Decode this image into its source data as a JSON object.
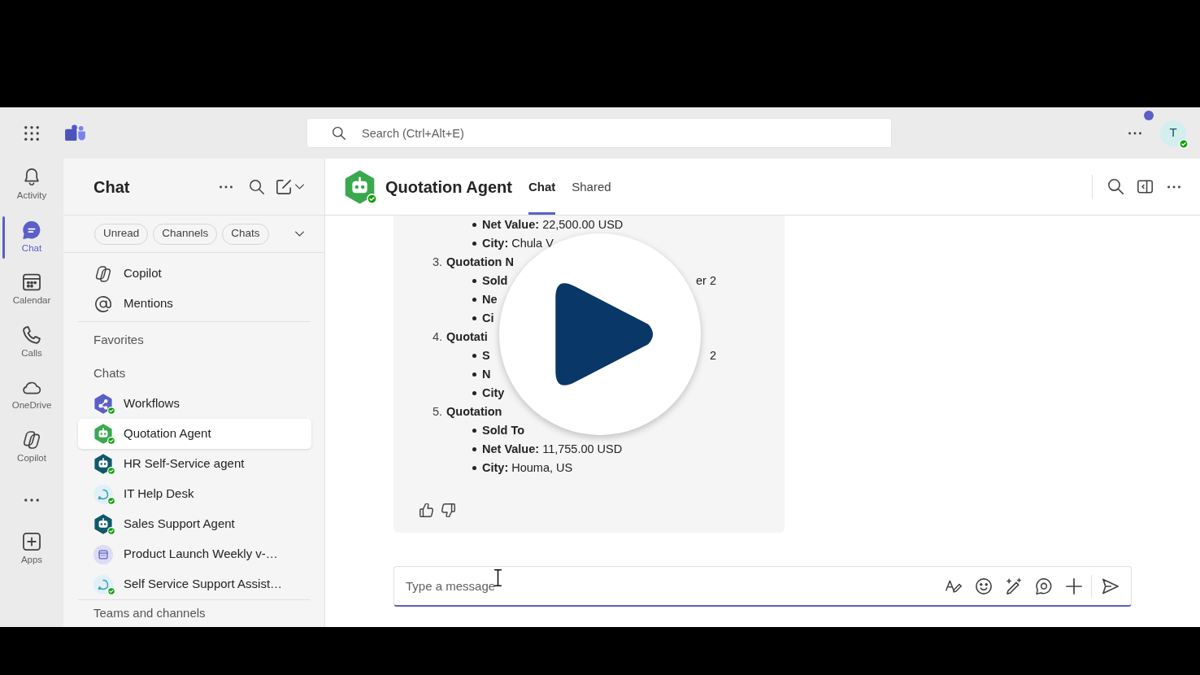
{
  "top_bar": {
    "search": {
      "placeholder": "Search (Ctrl+Alt+E)"
    },
    "account": {
      "initial": "T",
      "online": true
    }
  },
  "rail": {
    "items": [
      {
        "kind": "activity",
        "label": "Activity",
        "selected": false
      },
      {
        "kind": "chat",
        "label": "Chat",
        "selected": true
      },
      {
        "kind": "calendar",
        "label": "Calendar",
        "selected": false
      },
      {
        "kind": "calls",
        "label": "Calls",
        "selected": false
      },
      {
        "kind": "onedrive",
        "label": "OneDrive",
        "selected": false
      },
      {
        "kind": "copilot",
        "label": "Copilot",
        "selected": false
      },
      {
        "kind": "more",
        "selected": false
      },
      {
        "kind": "apps",
        "label": "Apps",
        "selected": false
      }
    ]
  },
  "chat_list": {
    "title": "Chat",
    "filters": [
      {
        "label": "Unread",
        "selected": false
      },
      {
        "label": "Channels",
        "selected": false
      },
      {
        "label": "Chats",
        "selected": false
      }
    ],
    "pinned": [
      {
        "kind": "copilot",
        "label": "Copilot"
      },
      {
        "kind": "mentions",
        "label": "Mentions"
      }
    ],
    "favorites": {
      "title": "Favorites"
    },
    "chats": {
      "title": "Chats",
      "items": [
        {
          "kind": "workflow",
          "label": "Workflows",
          "color": "#5b5fc7",
          "online": true,
          "selected": false
        },
        {
          "kind": "bot",
          "label": "Quotation Agent",
          "color": "#3aa84f",
          "online": true,
          "selected": true
        },
        {
          "kind": "bot",
          "label": "HR Self-Service agent",
          "color": "#0e5a6b",
          "online": true,
          "selected": false
        },
        {
          "kind": "helpdesk",
          "label": "IT Help Desk",
          "color": "#dff1f7",
          "online": true,
          "selected": false
        },
        {
          "kind": "bot",
          "label": "Sales Support Agent",
          "color": "#0e5a6b",
          "online": true,
          "selected": false
        },
        {
          "kind": "meeting",
          "label": "Product Launch Weekly v-…",
          "color": "#dcdcf4",
          "online": false,
          "selected": false
        },
        {
          "kind": "helpdesk",
          "label": "Self Service Support Assist…",
          "color": "#dff1f7",
          "online": true,
          "selected": false
        }
      ]
    },
    "teams": {
      "title": "Teams and channels"
    }
  },
  "conversation": {
    "title": "Quotation Agent",
    "online": true,
    "tabs": [
      {
        "label": "Chat",
        "selected": true
      },
      {
        "label": "Shared",
        "selected": false
      }
    ],
    "message": {
      "lines": [
        {
          "kind": "bullet",
          "label": "Net Value:",
          "value": "22,500.00 USD"
        },
        {
          "kind": "bullet",
          "label": "City:",
          "value": "Chula V"
        },
        {
          "kind": "numbered",
          "number": "3.",
          "label": "Quotation N"
        },
        {
          "kind": "bullet",
          "label": "Sold",
          "right_text": "er 2"
        },
        {
          "kind": "bullet",
          "label": "Ne"
        },
        {
          "kind": "bullet",
          "label": "Ci"
        },
        {
          "kind": "numbered",
          "number": "4.",
          "label": "Quotati"
        },
        {
          "kind": "bullet",
          "label": "S",
          "right_text": "2"
        },
        {
          "kind": "bullet",
          "label": "N"
        },
        {
          "kind": "bullet",
          "label": "City"
        },
        {
          "kind": "numbered",
          "number": "5.",
          "label": "Quotation"
        },
        {
          "kind": "bullet",
          "label": "Sold To"
        },
        {
          "kind": "bullet",
          "label": "Net Value:",
          "value": "11,755.00 USD"
        },
        {
          "kind": "bullet",
          "label": "City:",
          "value": "Houma, US"
        }
      ]
    },
    "composer": {
      "placeholder": "Type a message"
    }
  }
}
